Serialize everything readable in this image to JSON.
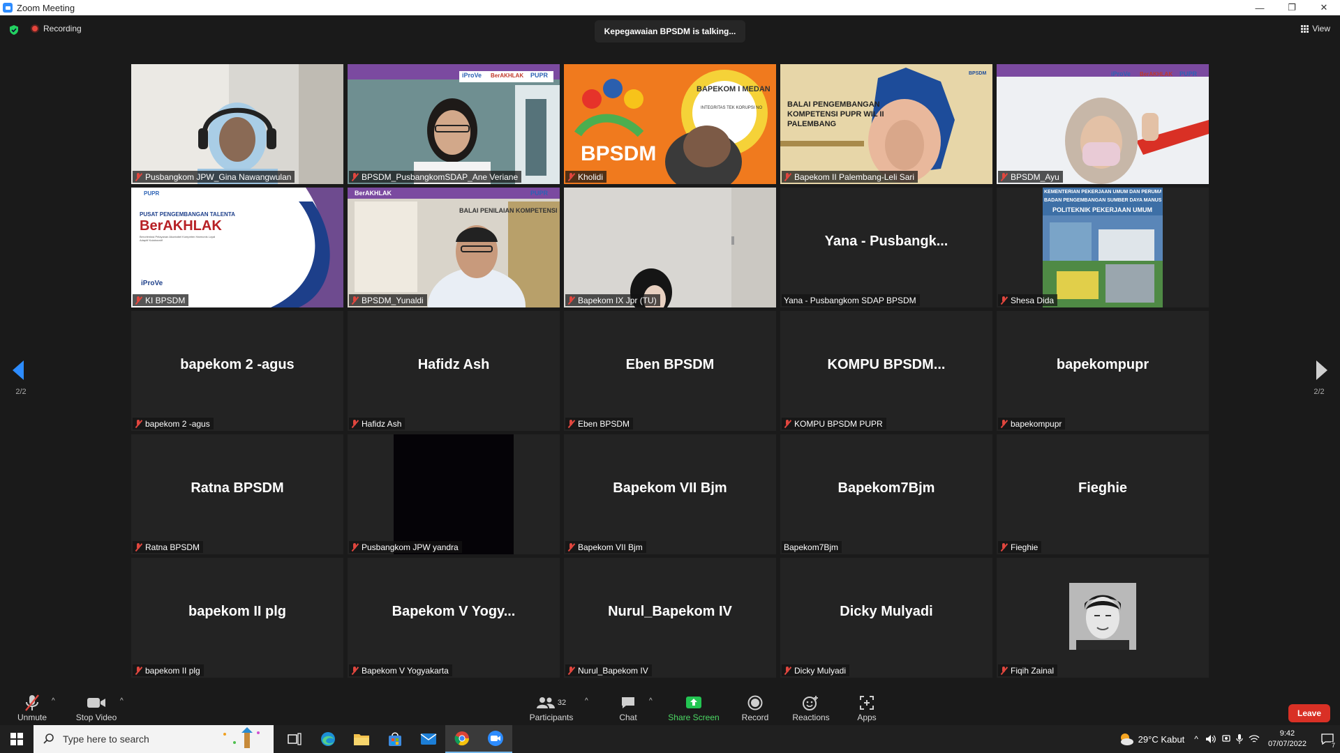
{
  "window": {
    "title": "Zoom Meeting",
    "minimize": "—",
    "maximize": "❐",
    "close": "✕"
  },
  "topbar": {
    "recording_label": "Recording",
    "talking": "Kepegawaian BPSDM is talking...",
    "view_label": "View"
  },
  "pager": {
    "left": "2/2",
    "right": "2/2"
  },
  "tiles": [
    {
      "name": "Pusbangkom JPW_Gina Nawangwulan",
      "big": "",
      "muted": true,
      "video": true
    },
    {
      "name": "BPSDM_PusbangkomSDAP_Ane Veriane",
      "big": "",
      "muted": true,
      "video": true
    },
    {
      "name": "Kholidi",
      "big": "",
      "muted": true,
      "video": true
    },
    {
      "name": "Bapekom II Palembang-Leli Sari",
      "big": "",
      "muted": true,
      "video": true
    },
    {
      "name": "BPSDM_Ayu",
      "big": "",
      "muted": true,
      "video": true
    },
    {
      "name": "KI BPSDM",
      "big": "",
      "muted": true,
      "video": true
    },
    {
      "name": "BPSDM_Yunaldi",
      "big": "",
      "muted": true,
      "video": true
    },
    {
      "name": "Bapekom IX Jpr (TU)",
      "big": "",
      "muted": true,
      "video": true
    },
    {
      "name": "Yana - Pusbangkom SDAP BPSDM",
      "big": "Yana - Pusbangk...",
      "muted": false,
      "video": false
    },
    {
      "name": "Shesa Dida",
      "big": "",
      "muted": true,
      "video": true
    },
    {
      "name": "bapekom 2 -agus",
      "big": "bapekom 2 -agus",
      "muted": true,
      "video": false
    },
    {
      "name": "Hafidz Ash",
      "big": "Hafidz Ash",
      "muted": true,
      "video": false
    },
    {
      "name": "Eben BPSDM",
      "big": "Eben BPSDM",
      "muted": true,
      "video": false
    },
    {
      "name": "KOMPU BPSDM PUPR",
      "big": "KOMPU BPSDM...",
      "muted": true,
      "video": false
    },
    {
      "name": "bapekompupr",
      "big": "bapekompupr",
      "muted": true,
      "video": false
    },
    {
      "name": "Ratna BPSDM",
      "big": "Ratna BPSDM",
      "muted": true,
      "video": false
    },
    {
      "name": "Pusbangkom JPW yandra",
      "big": "",
      "muted": true,
      "video": true
    },
    {
      "name": "Bapekom VII Bjm",
      "big": "Bapekom VII Bjm",
      "muted": true,
      "video": false
    },
    {
      "name": "Bapekom7Bjm",
      "big": "Bapekom7Bjm",
      "muted": false,
      "video": false
    },
    {
      "name": "Fieghie",
      "big": "Fieghie",
      "muted": true,
      "video": false
    },
    {
      "name": "bapekom II plg",
      "big": "bapekom II plg",
      "muted": true,
      "video": false
    },
    {
      "name": "Bapekom V Yogyakarta",
      "big": "Bapekom V Yogy...",
      "muted": true,
      "video": false
    },
    {
      "name": "Nurul_Bapekom IV",
      "big": "Nurul_Bapekom IV",
      "muted": true,
      "video": false
    },
    {
      "name": "Dicky Mulyadi",
      "big": "Dicky Mulyadi",
      "muted": true,
      "video": false
    },
    {
      "name": "Fiqih Zainal",
      "big": "",
      "muted": true,
      "video": false
    }
  ],
  "tile_text": {
    "iprove": "iProVe",
    "berakhlak": "BerAKHLAK",
    "pupr": "PUPR",
    "bpsdm": "BPSDM",
    "bapekom_medan": "BAPEKOM I MEDAN",
    "medan_sub": "INTEGRITAS TEK KORUPSI NO",
    "balai_1": "BALAI PENGEMBANGAN",
    "balai_2": "KOMPETENSI PUPR WIL II",
    "balai_3": "PALEMBANG",
    "pusat_talenta": "PUSAT PENGEMBANGAN TALENTA",
    "berakhlak_big": "BerAKHLAK",
    "berakhlak_tagline": "Berorientasi Pelayanan Akuntabel Kompeten Harmonis Loyal Adaptif Kolaboratif",
    "iprove_small": "iProVe",
    "penilaian": "BALAI PENILAIAN KOMPETENSI",
    "kementerian": "KEMENTERIAN PEKERJAAN UMUM DAN PERUMAHAN RAKYAT",
    "badan": "BADAN PENGEMBANGAN SUMBER DAYA MANUSIA",
    "politeknik": "POLITEKNIK PEKERJAAN UMUM"
  },
  "toolbar": {
    "unmute": "Unmute",
    "stop_video": "Stop Video",
    "participants": "Participants",
    "participants_count": "32",
    "chat": "Chat",
    "share_screen": "Share Screen",
    "record": "Record",
    "reactions": "Reactions",
    "apps": "Apps",
    "leave": "Leave"
  },
  "taskbar": {
    "search_placeholder": "Type here to search",
    "weather": "29°C  Kabut",
    "time": "9:42",
    "date": "07/07/2022",
    "notifications": "7"
  },
  "colors": {
    "accent": "#2d8cff",
    "leave": "#d93025",
    "share": "#4cd964",
    "muted": "#e0463e",
    "speaker": "#6ad86a"
  }
}
